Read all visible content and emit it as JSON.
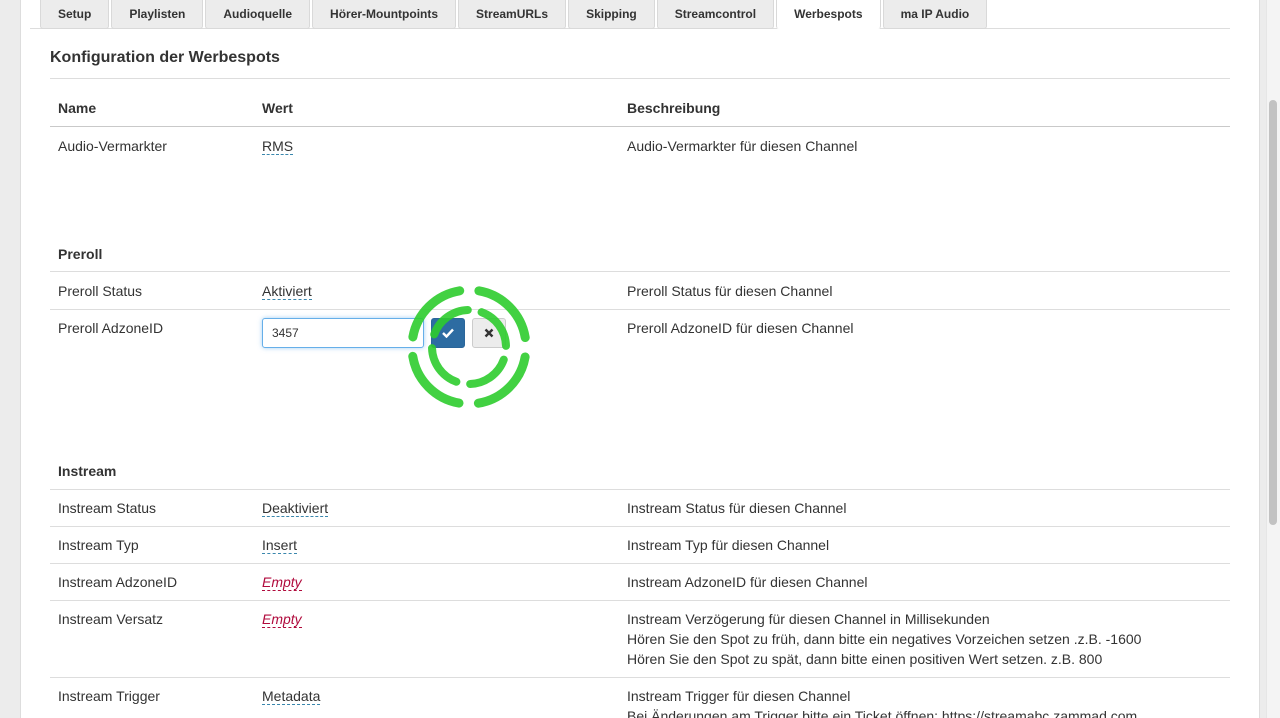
{
  "tabs": [
    {
      "label": "Setup"
    },
    {
      "label": "Playlisten"
    },
    {
      "label": "Audioquelle"
    },
    {
      "label": "Hörer-Mountpoints"
    },
    {
      "label": "StreamURLs"
    },
    {
      "label": "Skipping"
    },
    {
      "label": "Streamcontrol"
    },
    {
      "label": "Werbespots",
      "active": true
    },
    {
      "label": "ma IP Audio"
    }
  ],
  "title": "Konfiguration der Werbespots",
  "table": {
    "headers": {
      "name": "Name",
      "value": "Wert",
      "description": "Beschreibung"
    },
    "vermarkter": {
      "name": "Audio-Vermarkter",
      "value": "RMS",
      "description": "Audio-Vermarkter für diesen Channel"
    },
    "preroll_section": "Preroll",
    "preroll_status": {
      "name": "Preroll Status",
      "value": "Aktiviert",
      "description": "Preroll Status für diesen Channel"
    },
    "preroll_adzone": {
      "name": "Preroll AdzoneID",
      "input_value": "3457",
      "description": "Preroll AdzoneID für diesen Channel"
    },
    "instream_section": "Instream",
    "instream_status": {
      "name": "Instream Status",
      "value": "Deaktiviert",
      "description": "Instream Status für diesen Channel"
    },
    "instream_typ": {
      "name": "Instream Typ",
      "value": "Insert",
      "description": "Instream Typ für diesen Channel"
    },
    "instream_adzone": {
      "name": "Instream AdzoneID",
      "value": "Empty",
      "description": "Instream AdzoneID für diesen Channel"
    },
    "instream_versatz": {
      "name": "Instream Versatz",
      "value": "Empty",
      "description_lines": [
        "Instream Verzögerung für diesen Channel in Millisekunden",
        "Hören Sie den Spot zu früh, dann bitte ein negatives Vorzeichen setzen .z.B. -1600",
        "Hören Sie den Spot zu spät, dann bitte einen positiven Wert setzen. z.B. 800"
      ]
    },
    "instream_trigger": {
      "name": "Instream Trigger",
      "value": "Metadata",
      "description_lines": [
        "Instream Trigger für diesen Channel",
        "Bei Änderungen am Trigger bitte ein Ticket öffnen: https://streamabc.zammad.com"
      ]
    }
  },
  "icons": {
    "ok": "check-icon",
    "cancel": "close-icon"
  },
  "colors": {
    "accent": "#2d6ca2",
    "empty": "#b00a3c",
    "click_ring": "#2ecc2e"
  }
}
